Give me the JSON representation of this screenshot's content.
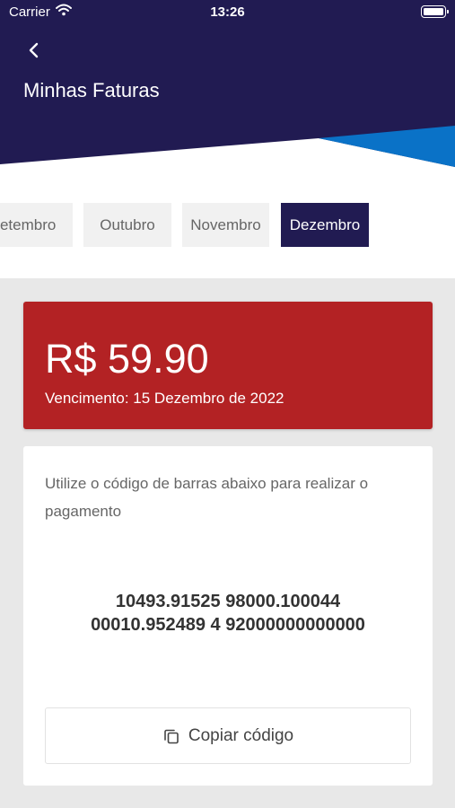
{
  "status_bar": {
    "carrier": "Carrier",
    "time": "13:26"
  },
  "header": {
    "title": "Minhas Faturas"
  },
  "months": [
    {
      "label": "Setembro",
      "active": false
    },
    {
      "label": "Outubro",
      "active": false
    },
    {
      "label": "Novembro",
      "active": false
    },
    {
      "label": "Dezembro",
      "active": true
    }
  ],
  "invoice": {
    "amount": "R$ 59.90",
    "due_date": "Vencimento: 15 Dezembro de 2022",
    "instruction": "Utilize o código de barras abaixo para realizar o pagamento",
    "barcode_line1": "10493.91525 98000.100044",
    "barcode_line2": "00010.952489 4 92000000000000",
    "copy_label": "Copiar código"
  },
  "colors": {
    "header": "#211b52",
    "accent_blue": "#0a72c7",
    "amount_card": "#b32224"
  }
}
